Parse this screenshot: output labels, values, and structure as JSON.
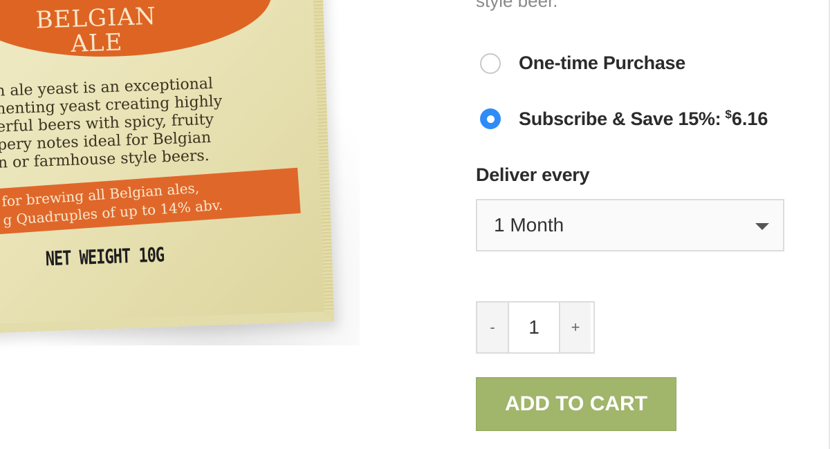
{
  "product_image": {
    "title_lines": "BELGIAN\nALE",
    "description_lines": "n ale yeast is an exceptional\nnenting yeast creating highly\nerful beers with spicy, fruity\npery notes ideal for Belgian\nn or farmhouse style beers.",
    "ribbon_lines": "for brewing all Belgian ales,\ng Quadruples of up to 14% abv.",
    "net_weight": "NET WEIGHT 10G",
    "colors": {
      "banner": "#de6423",
      "pouch": "#ebe5bb"
    }
  },
  "description_tail": "style beer.",
  "purchase_options": {
    "one_time_label": "One-time Purchase",
    "subscribe_label": "Subscribe & Save 15%:",
    "subscribe_currency": "$",
    "subscribe_price": "6.16",
    "selected": "subscribe"
  },
  "delivery": {
    "label": "Deliver every",
    "selected_value": "1 Month"
  },
  "quantity": {
    "minus_label": "-",
    "value": "1",
    "plus_label": "+"
  },
  "add_to_cart": {
    "label": "ADD TO CART",
    "color": "#a1b56b"
  },
  "colors": {
    "radio_selected": "#2f8cf6",
    "text": "#2b2b2b",
    "muted_text": "#8a8a8a"
  }
}
